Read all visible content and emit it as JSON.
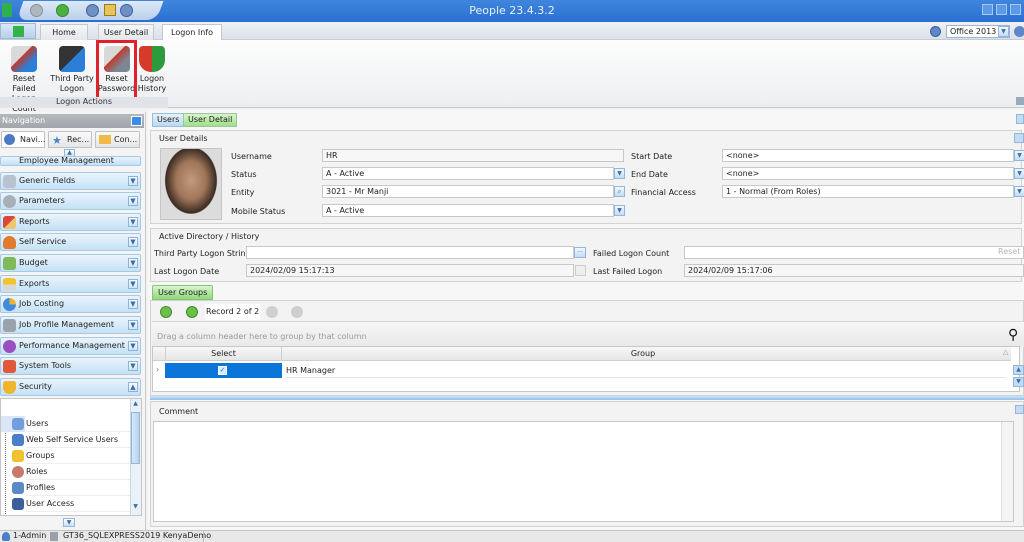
{
  "window": {
    "title": "People 23.4.3.2"
  },
  "ribbon_tabs": [
    {
      "label": "Home"
    },
    {
      "label": "User Detail"
    },
    {
      "label": "Logon Info",
      "active": true
    }
  ],
  "theme_selector": {
    "value": "Office 2013"
  },
  "ribbon": {
    "group_label": "Logon Actions",
    "buttons": [
      {
        "label_line1": "Reset Failed",
        "label_line2": "Logon Count"
      },
      {
        "label_line1": "Third Party",
        "label_line2": "Logon"
      },
      {
        "label_line1": "Reset",
        "label_line2": "Password",
        "highlighted": true
      },
      {
        "label_line1": "Logon",
        "label_line2": "History"
      }
    ]
  },
  "navigation": {
    "title": "Navigation",
    "tabs": [
      {
        "label": "Navi..."
      },
      {
        "label": "Rec..."
      },
      {
        "label": "Con..."
      }
    ],
    "groups": [
      {
        "label": "Employee Management"
      },
      {
        "label": "Generic Fields"
      },
      {
        "label": "Parameters"
      },
      {
        "label": "Reports"
      },
      {
        "label": "Self Service"
      },
      {
        "label": "Budget"
      },
      {
        "label": "Exports"
      },
      {
        "label": "Job Costing"
      },
      {
        "label": "Job Profile Management"
      },
      {
        "label": "Performance Management"
      },
      {
        "label": "System Tools"
      },
      {
        "label": "Security",
        "expanded": true
      }
    ],
    "security_items": [
      {
        "label": "Users",
        "selected": true
      },
      {
        "label": "Web Self Service Users"
      },
      {
        "label": "Groups"
      },
      {
        "label": "Roles"
      },
      {
        "label": "Profiles"
      },
      {
        "label": "User Access"
      }
    ]
  },
  "content_tabs": [
    {
      "label": "Users"
    },
    {
      "label": "User Detail",
      "active": true
    }
  ],
  "user_details": {
    "section_title": "User Details",
    "username_label": "Username",
    "username": "HR",
    "status_label": "Status",
    "status": "A - Active",
    "entity_label": "Entity",
    "entity": "3021 - Mr  Manji",
    "mobile_status_label": "Mobile Status",
    "mobile_status": "A - Active",
    "start_date_label": "Start Date",
    "start_date": "<none>",
    "end_date_label": "End Date",
    "end_date": "<none>",
    "financial_access_label": "Financial Access",
    "financial_access": "1 - Normal (From Roles)"
  },
  "history": {
    "section_title": "Active Directory / History",
    "third_party_label": "Third Party Logon String",
    "third_party": "",
    "last_logon_label": "Last Logon Date",
    "last_logon": "2024/02/09 15:17:13",
    "failed_count_label": "Failed Logon Count",
    "failed_count": "",
    "reset_label": "Reset",
    "last_failed_label": "Last Failed Logon",
    "last_failed": "2024/02/09 15:17:06"
  },
  "user_groups": {
    "tab_label": "User Groups",
    "record_text": "Record 2 of 2",
    "group_by_hint": "Drag a column header here to group by that column",
    "columns": [
      "Select",
      "Group"
    ],
    "rows": [
      {
        "selected": true,
        "group": "HR Manager"
      }
    ]
  },
  "comment": {
    "label": "Comment",
    "value": ""
  },
  "statusbar": {
    "user": "1-Admin",
    "server": "GT36_SQLEXPRESS2019 KenyaDemo"
  }
}
